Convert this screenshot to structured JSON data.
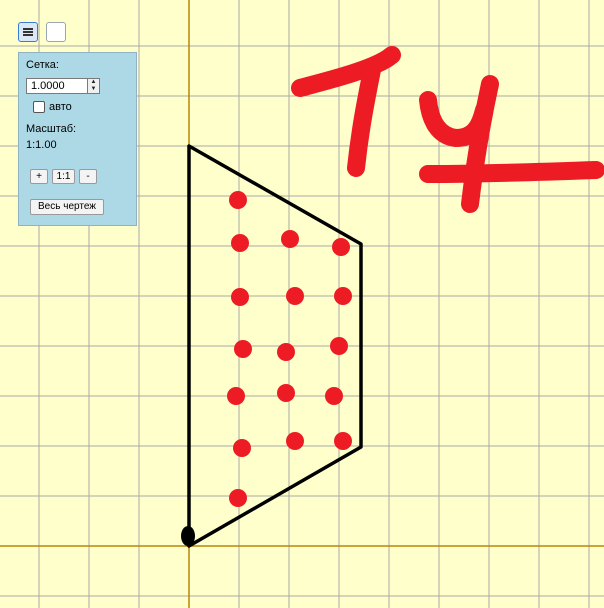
{
  "toolbar": {
    "menu_icon": "menu-icon"
  },
  "panel": {
    "grid_label": "Сетка:",
    "grid_value": "1.0000",
    "auto_label": "авто",
    "auto_checked": false,
    "scale_label": "Масштаб:",
    "scale_value": "1:1.00",
    "zoom_in": "+",
    "zoom_reset": "1:1",
    "zoom_out": "-",
    "fit_all": "Весь чертеж"
  },
  "drawing": {
    "handwriting": "ТЧ",
    "shape": "trapezoid",
    "dot_count": 18,
    "colors": {
      "background": "#ffffcc",
      "grid": "#a8a8a8",
      "axis": "#b8860b",
      "ink": "#000000",
      "marker": "#ed1c24"
    }
  }
}
